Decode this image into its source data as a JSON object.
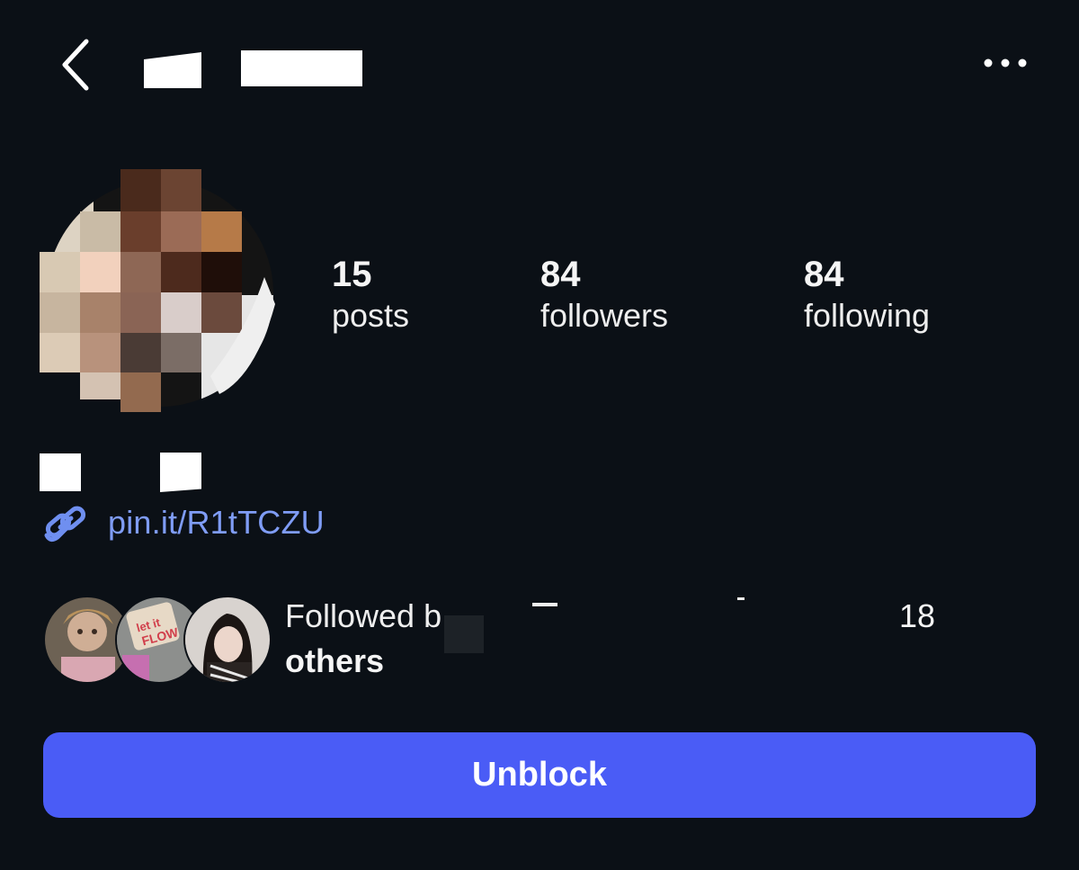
{
  "header": {
    "back_icon": "chevron-left-icon",
    "more_icon": "more-horizontal-icon"
  },
  "stats": {
    "posts_count": "15",
    "posts_label": "posts",
    "followers_count": "84",
    "followers_label": "followers",
    "following_count": "84",
    "following_label": "following"
  },
  "profile": {
    "link_icon": "link-icon",
    "link_text": "pin.it/R1tTCZU"
  },
  "followed_by": {
    "prefix": "Followed b",
    "count": "18",
    "suffix": "others"
  },
  "actions": {
    "unblock_label": "Unblock",
    "unblock_color": "#4a5cf6"
  },
  "colors": {
    "background": "#0b1016",
    "link": "#7f9cf5"
  }
}
